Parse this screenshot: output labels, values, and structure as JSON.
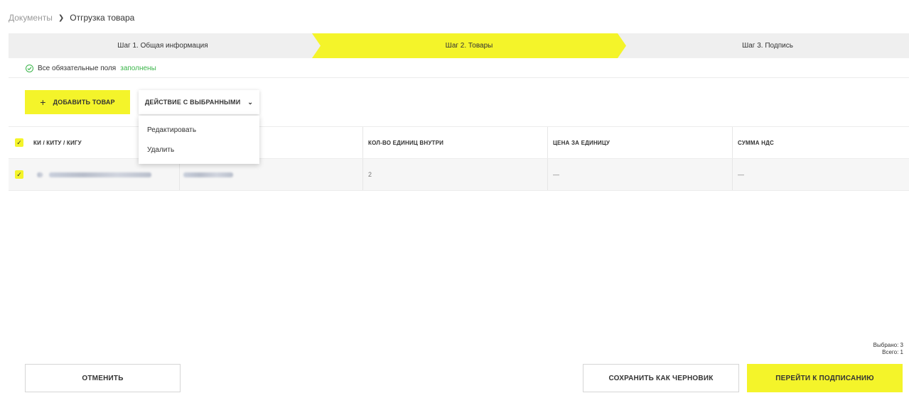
{
  "breadcrumb": {
    "parent": "Документы",
    "current": "Отгрузка товара"
  },
  "stepper": {
    "steps": [
      {
        "label": "Шаг 1. Общая информация"
      },
      {
        "label": "Шаг 2. Товары"
      },
      {
        "label": "Шаг 3. Подпись"
      }
    ],
    "active_index": 1,
    "active_color": "#f4f42a"
  },
  "status": {
    "text": "Все обязательные поля",
    "highlight": "заполнены",
    "color": "#3bb54a"
  },
  "toolbar": {
    "add_label": "ДОБАВИТЬ ТОВАР",
    "action_label": "ДЕЙСТВИЕ С ВЫБРАННЫМИ"
  },
  "dropdown": {
    "items": [
      "Редактировать",
      "Удалить"
    ]
  },
  "table": {
    "columns": [
      "КИ / КИТУ / КИГУ",
      "КОЛ-ВО ЕДИНИЦ ВНУТРИ",
      "ЦЕНА ЗА ЕДИНИЦУ",
      "СУММА НДС"
    ],
    "rows": [
      {
        "qty": "2",
        "price": "—",
        "vat": "—"
      }
    ]
  },
  "counters": {
    "selected": "Выбрано: 3",
    "total": "Всего: 1"
  },
  "footer": {
    "cancel_label": "ОТМЕНИТЬ",
    "draft_label": "СОХРАНИТЬ КАК ЧЕРНОВИК",
    "sign_label": "ПЕРЕЙТИ К ПОДПИСАНИЮ"
  }
}
